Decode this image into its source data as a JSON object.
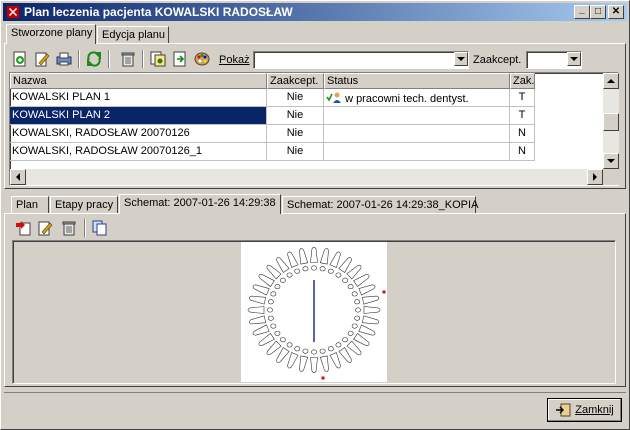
{
  "window": {
    "title": "Plan leczenia pacjenta KOWALSKI RADOSŁAW",
    "minimize": "_",
    "maximize": "□",
    "close": "✕"
  },
  "top_tabs": [
    {
      "label": "Stworzone plany",
      "active": true
    },
    {
      "label": "Edycja planu",
      "active": false
    }
  ],
  "toolbar": {
    "pokaz_label": "Pokaż",
    "pokaz_value": "",
    "zaakcept_label": "Zaakcept.",
    "zaakcept_value": "",
    "icons": [
      "add-plan-icon",
      "edit-plan-icon",
      "print-icon",
      "refresh-icon",
      "delete-icon",
      "copy-icon",
      "export-icon",
      "palette-icon"
    ]
  },
  "grid": {
    "columns": [
      "Nazwa",
      "Zaakcept.",
      "Status",
      "Zak."
    ],
    "rows": [
      {
        "name": "KOWALSKI PLAN 1",
        "accepted": "Nie",
        "status": "w pracowni tech. dentyst.",
        "zak": "T",
        "selected": false
      },
      {
        "name": "KOWALSKI PLAN 2",
        "accepted": "Nie",
        "status": "",
        "zak": "T",
        "selected": true
      },
      {
        "name": "KOWALSKI, RADOSŁAW 20070126",
        "accepted": "Nie",
        "status": "",
        "zak": "N",
        "selected": false
      },
      {
        "name": "KOWALSKI, RADOSŁAW 20070126_1",
        "accepted": "Nie",
        "status": "",
        "zak": "N",
        "selected": false
      }
    ]
  },
  "bottom_tabs": [
    {
      "label": "Plan",
      "active": false
    },
    {
      "label": "Etapy pracy",
      "active": false
    },
    {
      "label": "Schemat: 2007-01-26 14:29:38",
      "active": true
    },
    {
      "label": "Schemat: 2007-01-26 14:29:38_KOPIA",
      "active": false
    }
  ],
  "schema_toolbar": {
    "icons": [
      "new-schema-icon",
      "edit-schema-icon",
      "delete-schema-icon",
      "copy-schema-icon"
    ]
  },
  "footer": {
    "close_label": "Zamknij"
  },
  "colors": {
    "title_start": "#0a246a",
    "title_end": "#a6caf0",
    "selection": "#0a246a",
    "face": "#d4d0c8"
  }
}
